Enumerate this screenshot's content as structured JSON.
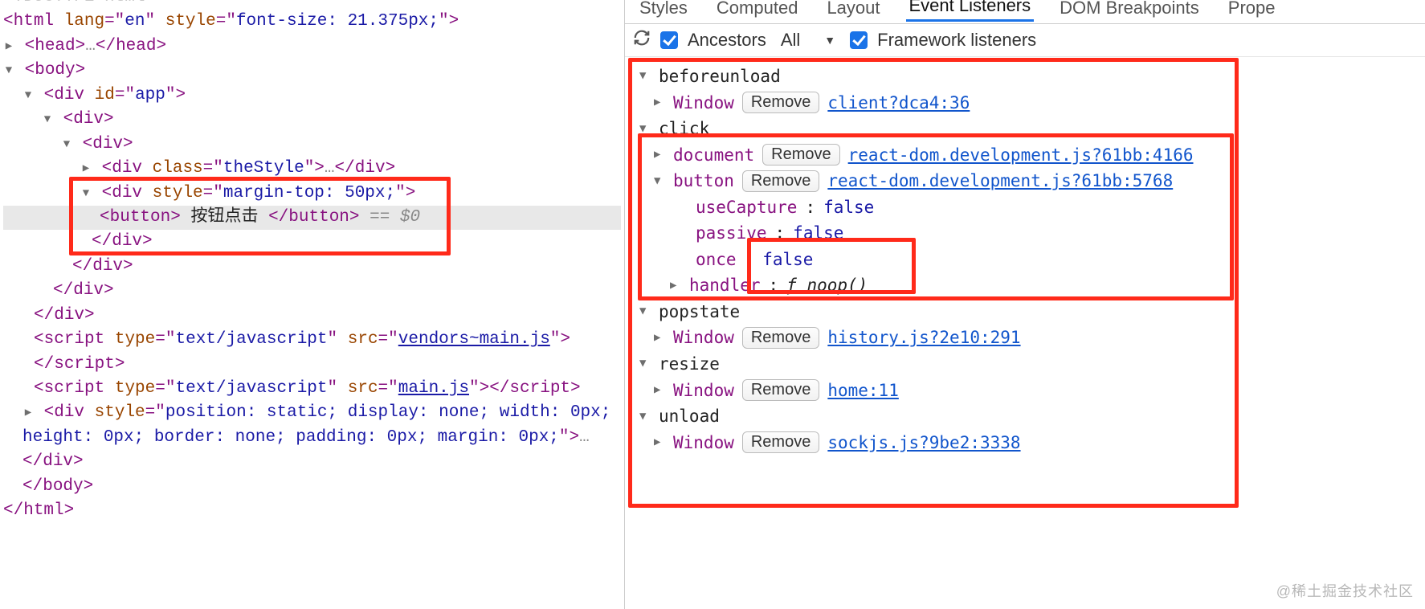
{
  "dom": {
    "doctype_faded": "<!DOCTYPE html>",
    "html_open": {
      "tag": "html",
      "lang_attr": "lang",
      "lang_val": "en",
      "style_attr": "style",
      "style_val": "font-size: 21.375px;"
    },
    "head": {
      "open_tag": "head",
      "ellipsis": "…",
      "close": "head"
    },
    "body_tag": "body",
    "app": {
      "tag": "div",
      "id_attr": "id",
      "id_val": "app"
    },
    "div_plain": "div",
    "thestyle": {
      "tag": "div",
      "class_attr": "class",
      "class_val": "theStyle",
      "ellipsis": "…"
    },
    "margin_div": {
      "tag": "div",
      "style_attr": "style",
      "style_val": "margin-top: 50px;"
    },
    "button": {
      "tag": "button",
      "text": " 按钮点击 ",
      "selected_suffix": " == $0"
    },
    "script1": {
      "tag": "script",
      "type_attr": "type",
      "type_val": "text/javascript",
      "src_attr": "src",
      "src_val": "vendors~main.js"
    },
    "script2": {
      "tag": "script",
      "type_attr": "type",
      "type_val": "text/javascript",
      "src_attr": "src",
      "src_val": "main.js"
    },
    "hidden_div": {
      "tag": "div",
      "style_attr": "style",
      "style_val_line1": "position: static; display: none; width: 0px;",
      "style_val_line2": "height: 0px; border: none; padding: 0px; margin: 0px;",
      "ellipsis": "…"
    }
  },
  "tabs": {
    "styles": "Styles",
    "computed": "Computed",
    "layout": "Layout",
    "event_listeners": "Event Listeners",
    "dom_breakpoints": "DOM Breakpoints",
    "properties": "Prope"
  },
  "toolbar": {
    "ancestors_label": "Ancestors",
    "scope_selected": "All",
    "framework_label": "Framework listeners"
  },
  "listeners": {
    "beforeunload": {
      "name": "beforeunload",
      "window": {
        "target": "Window",
        "remove": "Remove",
        "link": "client?dca4:36"
      }
    },
    "click": {
      "name": "click",
      "document": {
        "target": "document",
        "remove": "Remove",
        "link": "react-dom.development.js?61bb:4166"
      },
      "button": {
        "target": "button",
        "remove": "Remove",
        "link": "react-dom.development.js?61bb:5768",
        "useCapture": {
          "k": "useCapture",
          "v": "false"
        },
        "passive": {
          "k": "passive",
          "v": "false"
        },
        "once": {
          "k": "once",
          "v": "false"
        },
        "handler": {
          "k": "handler",
          "fn": "ƒ noop()"
        }
      }
    },
    "popstate": {
      "name": "popstate",
      "window": {
        "target": "Window",
        "remove": "Remove",
        "link": "history.js?2e10:291"
      }
    },
    "resize": {
      "name": "resize",
      "window": {
        "target": "Window",
        "remove": "Remove",
        "link": "home:11"
      }
    },
    "unload": {
      "name": "unload",
      "window": {
        "target": "Window",
        "remove": "Remove",
        "link": "sockjs.js?9be2:3338"
      }
    }
  },
  "watermark": "@稀土掘金技术社区"
}
